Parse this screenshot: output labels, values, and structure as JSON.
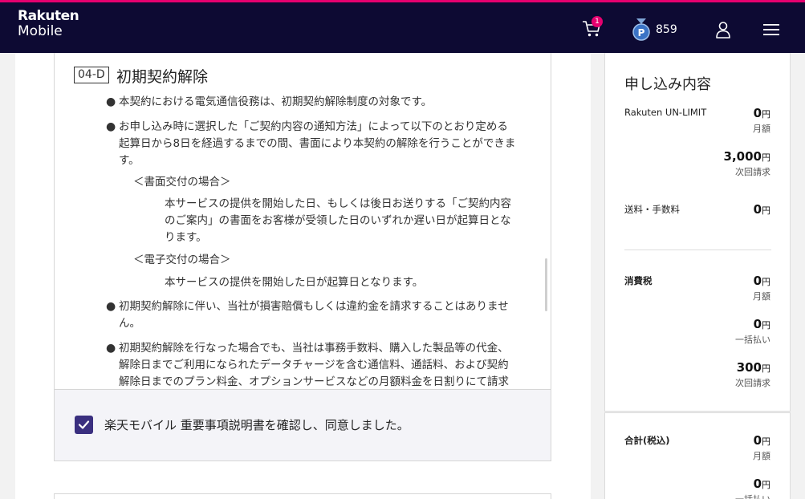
{
  "header": {
    "logo_line1": "Rakuten",
    "logo_line2": "Mobile",
    "cart_count": "1",
    "points": "859",
    "colors": {
      "bar": "#0d0a33",
      "accent": "#e5006f"
    },
    "icons": [
      "cart-icon",
      "points-medal-icon",
      "user-icon",
      "hamburger-menu-icon"
    ]
  },
  "section": {
    "tag": "04-D",
    "title": "初期契約解除",
    "bullet1": "本契約における電気通信役務は、初期契約解除制度の対象です。",
    "bullet2_l1": "お申し込み時に選択した「ご契約内容の通知方法」によって以下のとおり定める",
    "bullet2_l2": "起算日から8日を経過するまでの間、書面により本契約の解除を行うことができま",
    "bullet2_l3": "す。",
    "sub1_head": "＜書面交付の場合＞",
    "sub1_l1": "本サービスの提供を開始した日、もしくは後日お送りする「ご契約内容",
    "sub1_l2": "のご案内」の書面をお客様が受領した日のいずれか遅い日が起算日とな",
    "sub1_l3": "ります。",
    "sub2_head": "＜電子交付の場合＞",
    "sub2_l1": "本サービスの提供を開始した日が起算日となります。",
    "bullet3_l1": "初期契約解除に伴い、当社が損害賠償もしくは違約金を請求することはありませ",
    "bullet3_l2": "ん。",
    "bullet4_l1": "初期契約解除を行なった場合でも、当社は事務手数料、購入した製品等の代金、",
    "bullet4_l2": "解除日までご利用になられたデータチャージを含む通信料、通話料、および契約",
    "bullet4_l3": "解除日までのプラン料金、オプションサービスなどの月額料金を日割りにて請求",
    "bullet_mark": "●"
  },
  "agreement": {
    "checked": true,
    "label": "楽天モバイル 重要事項説明書を確認し、同意しました。"
  },
  "summary": {
    "title": "申し込み内容",
    "yen": "円",
    "plan": {
      "label": "Rakuten UN-LIMIT",
      "monthly": "0",
      "monthly_note": "月額",
      "next": "3,000",
      "next_note": "次回請求"
    },
    "fees": {
      "label": "送料・手数料",
      "amount": "0"
    },
    "tax": {
      "label": "消費税",
      "monthly": "0",
      "monthly_note": "月額",
      "lump": "0",
      "lump_note": "一括払い",
      "next": "300",
      "next_note": "次回請求"
    },
    "total": {
      "label": "合計(税込)",
      "monthly": "0",
      "monthly_note": "月額",
      "lump": "0",
      "lump_note": "一括払い"
    }
  }
}
